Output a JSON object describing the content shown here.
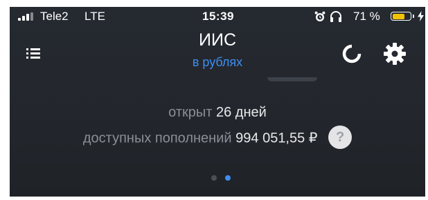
{
  "status_bar": {
    "carrier": "Tele2",
    "network": "LTE",
    "time": "15:39",
    "battery_percent": "71 %",
    "battery_level": 0.71,
    "icons": [
      "signal-icon",
      "alarm-icon",
      "headphones-icon",
      "battery-icon",
      "charging-icon"
    ]
  },
  "nav": {
    "title": "ИИС",
    "subtitle": "в рублях",
    "menu_icon": "list-icon",
    "refresh_icon": "refresh-icon",
    "settings_icon": "gear-icon"
  },
  "info": {
    "opened_label": "открыт",
    "opened_value": "26 дней",
    "available_label": "доступных пополнений",
    "available_value": "994 051,55 ₽",
    "help_label": "?"
  },
  "pager": {
    "total": 2,
    "active": 2
  },
  "colors": {
    "background": "#23272d",
    "accent": "#3d8ef0",
    "muted_text": "#8a8f97",
    "battery": "#f3c300"
  }
}
